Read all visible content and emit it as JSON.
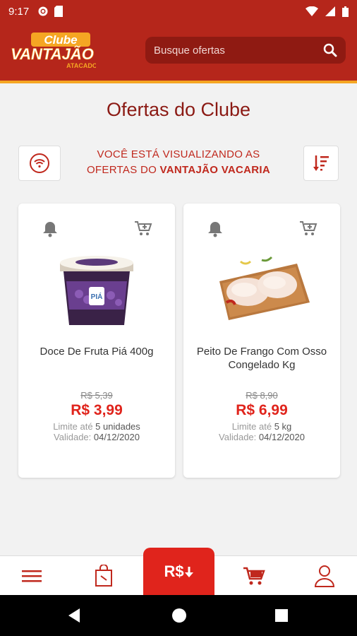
{
  "status": {
    "time": "9:17"
  },
  "header": {
    "logo_top": "Clube",
    "logo_main": "VANTAJÃO",
    "logo_sub": "ATACADO",
    "search_placeholder": "Busque ofertas"
  },
  "page": {
    "title": "Ofertas do Clube",
    "info_line1": "VOCÊ ESTÁ VISUALIZANDO AS",
    "info_line2_prefix": "OFERTAS DO ",
    "info_line2_store": "VANTAJÃO VACARIA"
  },
  "products": [
    {
      "name": "Doce De Fruta Piá 400g",
      "old_price": "R$ 5,39",
      "new_price": "R$ 3,99",
      "limit_label": "Limite até ",
      "limit_value": "5 unidades",
      "valid_label": "Validade: ",
      "valid_value": "04/12/2020"
    },
    {
      "name": "Peito De Frango Com Osso Congelado Kg",
      "old_price": "R$ 8,90",
      "new_price": "R$ 6,99",
      "limit_label": "Limite até ",
      "limit_value": "5 kg",
      "valid_label": "Validade: ",
      "valid_value": "04/12/2020"
    }
  ],
  "bottom_nav": {
    "center_label": "R$"
  },
  "colors": {
    "brand_red": "#b5261b",
    "accent_red": "#e0241c",
    "accent_orange": "#f5a623"
  }
}
